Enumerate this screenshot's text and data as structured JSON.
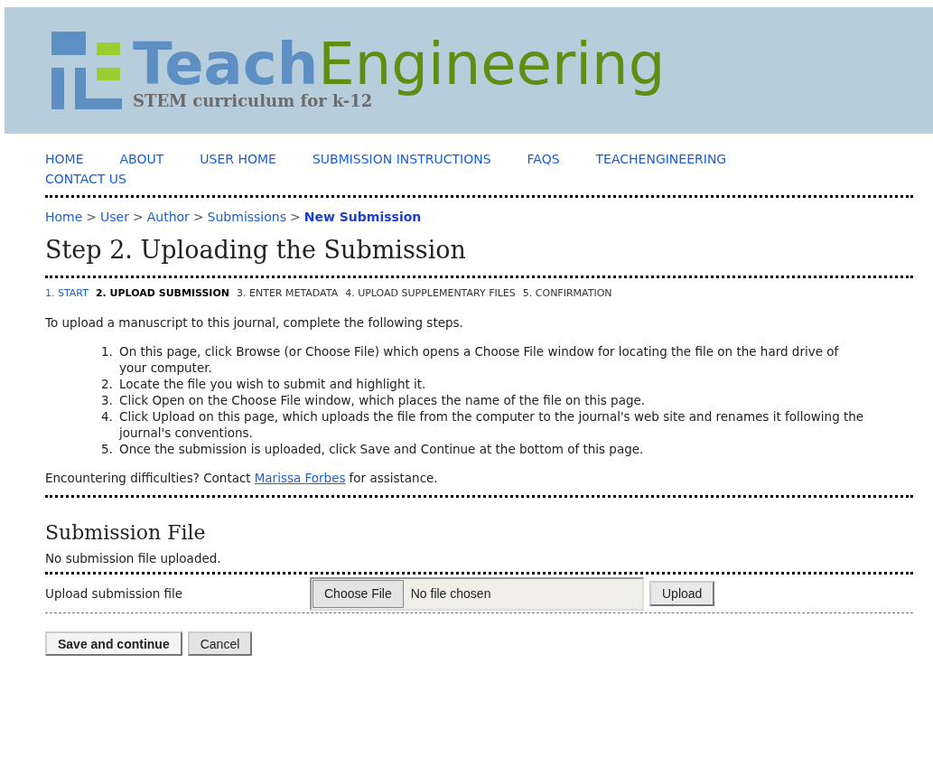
{
  "header": {
    "logo_word_1": "Teach",
    "logo_word_2": "Engineering",
    "tagline": "STEM curriculum for k-12"
  },
  "nav": [
    "HOME",
    "ABOUT",
    "USER HOME",
    "SUBMISSION INSTRUCTIONS",
    "FAQS",
    "TEACHENGINEERING",
    "CONTACT US"
  ],
  "breadcrumb": [
    {
      "label": "Home",
      "selected": false
    },
    {
      "label": "User",
      "selected": false
    },
    {
      "label": "Author",
      "selected": false
    },
    {
      "label": "Submissions",
      "selected": false
    },
    {
      "label": "New Submission",
      "selected": true
    }
  ],
  "breadcrumb_separator": ">",
  "title": "Step 2. Uploading the Submission",
  "steps": [
    {
      "label": "1. START",
      "selected": false,
      "link": true
    },
    {
      "label": "2. UPLOAD SUBMISSION",
      "selected": true,
      "link": false
    },
    {
      "label": "3. ENTER METADATA",
      "selected": false,
      "link": false
    },
    {
      "label": "4. UPLOAD SUPPLEMENTARY FILES",
      "selected": false,
      "link": false
    },
    {
      "label": "5. CONFIRMATION",
      "selected": false,
      "link": false
    }
  ],
  "intro": "To upload a manuscript to this journal, complete the following steps.",
  "instructions": [
    {
      "number": "1.",
      "text": "On this page, click Browse (or Choose File) which opens a Choose File window for locating the file on the hard drive of your computer."
    },
    {
      "number": "2.",
      "text": "Locate the file you wish to submit and highlight it."
    },
    {
      "number": "3.",
      "text": "Click Open on the Choose File window, which places the name of the file on this page."
    },
    {
      "number": "4.",
      "text": "Click Upload on this page, which uploads the file from the computer to the journal's web site and renames it following the journal's conventions."
    },
    {
      "number": "5.",
      "text": "Once the submission is uploaded, click Save and Continue at the bottom of this page."
    }
  ],
  "help": {
    "before": "Encountering difficulties? Contact",
    "link": "Marissa Forbes",
    "after": "for assistance."
  },
  "section": {
    "title": "Submission File",
    "status": "No submission file uploaded.",
    "field_label": "Upload submission file",
    "choose_button": "Choose File",
    "file_status": "No file chosen",
    "upload_button": "Upload"
  },
  "buttons": [
    {
      "label": "Save and continue",
      "kind": "primary"
    },
    {
      "label": "Cancel",
      "kind": "secondary"
    }
  ]
}
